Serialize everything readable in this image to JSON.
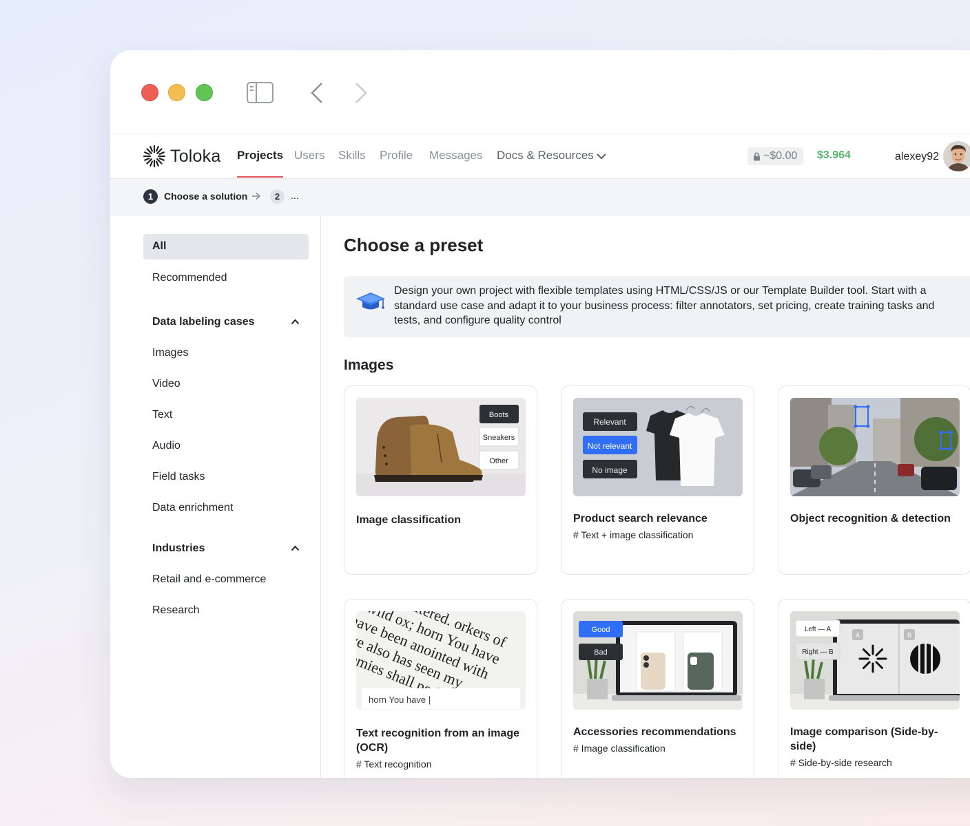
{
  "app": {
    "logo_text": "Toloka",
    "nav": [
      "Projects",
      "Users",
      "Skills",
      "Profile",
      "Messages",
      "Docs & Resources"
    ],
    "locked_balance": "~$0.00",
    "balance": "$3.964",
    "username": "alexey92"
  },
  "breadcrumb": {
    "step1_num": "1",
    "step1_label": "Choose a solution",
    "step2_num": "2",
    "step2_label": "..."
  },
  "sidebar": {
    "all": "All",
    "recommended": "Recommended",
    "cases_header": "Data labeling cases",
    "cases": [
      "Images",
      "Video",
      "Text",
      "Audio",
      "Field tasks",
      "Data enrichment"
    ],
    "industries_header": "Industries",
    "industries": [
      "Retail and e-commerce",
      "Research"
    ]
  },
  "main": {
    "title": "Choose a preset",
    "info": "Design your own project with flexible templates using HTML/CSS/JS or our Template Builder tool. Start with a standard use case and adapt it to your business process: filter annotators, set pricing, create training tasks and tests, and configure quality control",
    "section": "Images",
    "cards": [
      {
        "title": "Image classification",
        "tag": "",
        "thumb_labels": [
          "Boots",
          "Sneakers",
          "Other"
        ]
      },
      {
        "title": "Product search relevance",
        "tag": "# Text + image classification",
        "thumb_labels": [
          "Relevant",
          "Not relevant",
          "No image"
        ]
      },
      {
        "title": "Object recognition & detection",
        "tag": "",
        "thumb_labels": []
      },
      {
        "title": "Text recognition from an image (OCR)",
        "tag": "# Text recognition",
        "thumb_labels": [
          "horn You have |"
        ]
      },
      {
        "title": "Accessories recommendations",
        "tag": "# Image classification",
        "thumb_labels": [
          "Good",
          "Bad"
        ]
      },
      {
        "title": "Image comparison (Side-by-side)",
        "tag": "# Side-by-side research",
        "thumb_labels": [
          "Left — A",
          "Right — B",
          "A",
          "B"
        ]
      }
    ]
  },
  "colors": {
    "accent_underline": "#e0535c",
    "balance_green": "#5ab56b",
    "selected_blue": "#2f6ef5"
  }
}
